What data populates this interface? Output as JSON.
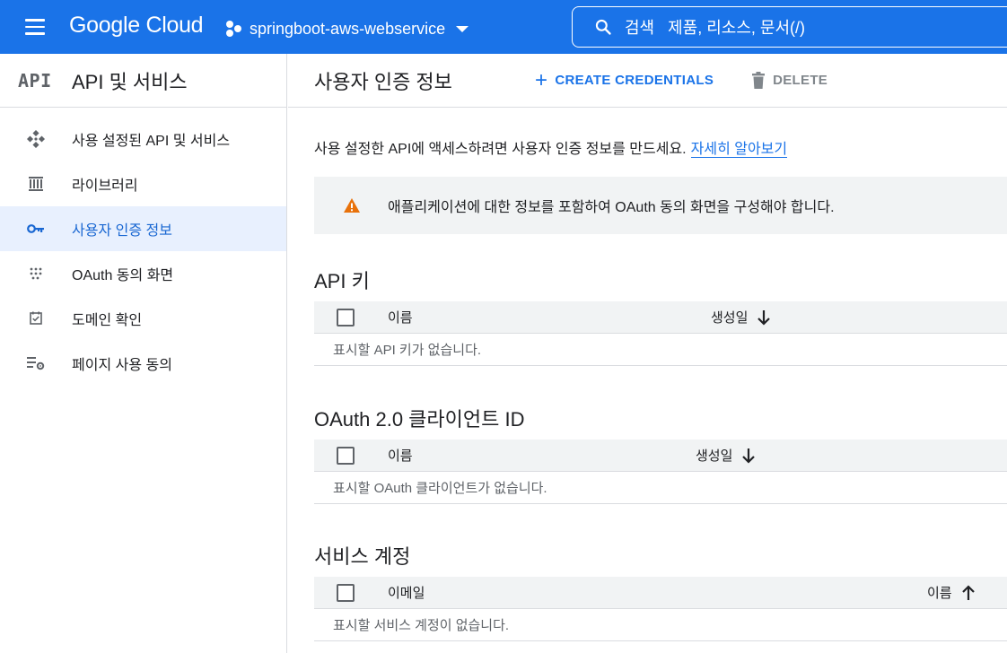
{
  "header": {
    "logo": "Google Cloud",
    "project": "springboot-aws-webservice",
    "search_placeholder": "검색   제품, 리소스, 문서(/)"
  },
  "sidebar": {
    "badge": "API",
    "title": "API 및 서비스",
    "items": [
      {
        "label": "사용 설정된 API 및 서비스",
        "icon": "api-diamond-icon",
        "active": false
      },
      {
        "label": "라이브러리",
        "icon": "library-icon",
        "active": false
      },
      {
        "label": "사용자 인증 정보",
        "icon": "key-icon",
        "active": true
      },
      {
        "label": "OAuth 동의 화면",
        "icon": "dots-grid-icon",
        "active": false
      },
      {
        "label": "도메인 확인",
        "icon": "checkbox-icon",
        "active": false
      },
      {
        "label": "페이지 사용 동의",
        "icon": "settings-list-icon",
        "active": false
      }
    ]
  },
  "main": {
    "title": "사용자 인증 정보",
    "create_label": "CREATE CREDENTIALS",
    "delete_label": "DELETE",
    "intro_text": "사용 설정한 API에 액세스하려면 사용자 인증 정보를 만드세요.",
    "intro_link": "자세히 알아보기",
    "warning_text": "애플리케이션에 대한 정보를 포함하여 OAuth 동의 화면을 구성해야 합니다.",
    "sections": [
      {
        "title": "API 키",
        "col1": "이름",
        "sort_col": "생성일",
        "sort_dir": "desc",
        "empty": "표시할 API 키가 없습니다."
      },
      {
        "title": "OAuth 2.0 클라이언트 ID",
        "col1": "이름",
        "sort_col": "생성일",
        "sort_dir": "desc",
        "empty": "표시할 OAuth 클라이언트가 없습니다."
      },
      {
        "title": "서비스 계정",
        "col1": "이메일",
        "sort_col": "이름",
        "sort_dir": "asc",
        "empty": "표시할 서비스 계정이 없습니다."
      }
    ]
  },
  "colors": {
    "brand": "#1a73e8",
    "active_bg": "#e8f0fe",
    "warning": "#e8710a"
  }
}
